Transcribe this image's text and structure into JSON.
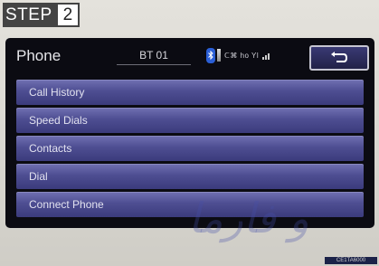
{
  "step": {
    "word": "STEP",
    "number": "2"
  },
  "screen": {
    "title": "Phone",
    "device_name": "BT 01",
    "status_text": "ᑕ⌘ ho Yl",
    "menu": [
      {
        "label": "Call History"
      },
      {
        "label": "Speed Dials"
      },
      {
        "label": "Contacts"
      },
      {
        "label": "Dial"
      },
      {
        "label": "Connect Phone"
      }
    ]
  },
  "watermark": "و فارما",
  "image_code": "CE1TA6000"
}
